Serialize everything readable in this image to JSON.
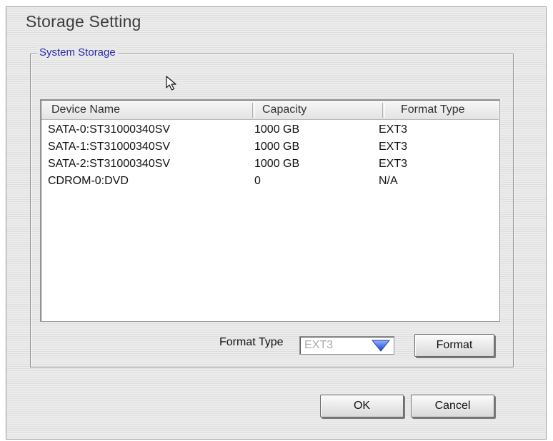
{
  "window": {
    "title": "Storage Setting"
  },
  "system_storage": {
    "legend": "System Storage",
    "columns": [
      "Device Name",
      "Capacity",
      "Format Type"
    ],
    "rows": [
      {
        "device": "SATA-0:ST31000340SV",
        "capacity": "1000 GB",
        "format": "EXT3"
      },
      {
        "device": "SATA-1:ST31000340SV",
        "capacity": "1000 GB",
        "format": "EXT3"
      },
      {
        "device": "SATA-2:ST31000340SV",
        "capacity": "1000 GB",
        "format": "EXT3"
      },
      {
        "device": "CDROM-0:DVD",
        "capacity": "0",
        "format": "N/A"
      }
    ],
    "format_type_label": "Format Type",
    "format_type_value": "EXT3",
    "format_button": "Format"
  },
  "footer": {
    "ok": "OK",
    "cancel": "Cancel"
  },
  "icons": {
    "cursor": "arrow-cursor-icon",
    "dropdown": "dropdown-arrow-icon"
  },
  "colors": {
    "legend_text": "#2a2aa8",
    "dropdown_arrow": "#3a5fd8"
  }
}
